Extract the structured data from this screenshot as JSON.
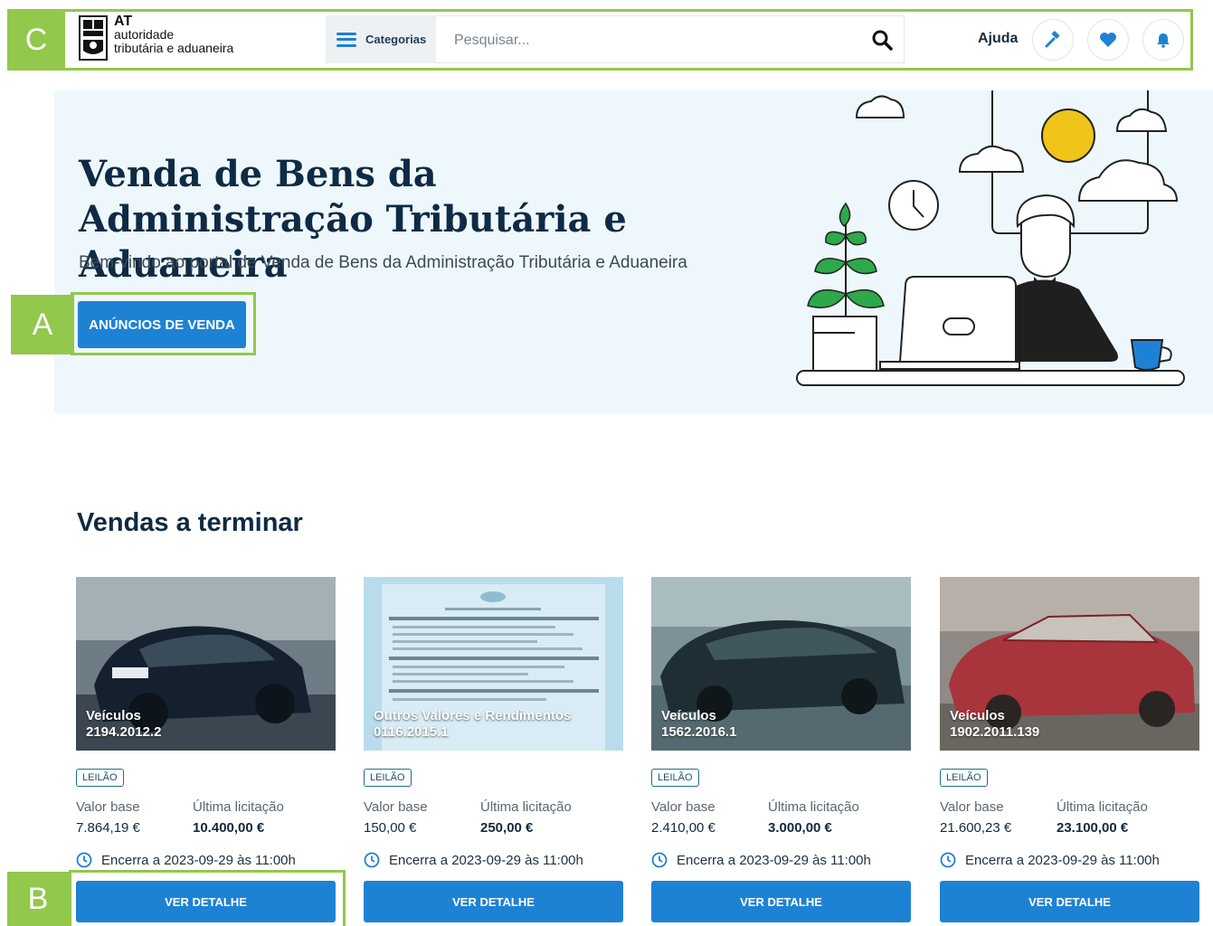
{
  "annotations": {
    "a": "A",
    "b": "B",
    "c": "C"
  },
  "header": {
    "logo_at": "AT",
    "logo_line1": "autoridade",
    "logo_line2": "tributária e aduaneira",
    "categories_label": "Categorias",
    "search_placeholder": "Pesquisar...",
    "help_label": "Ajuda",
    "icons": [
      "gavel-icon",
      "heart-icon",
      "bell-icon"
    ]
  },
  "hero": {
    "title": "Venda de Bens da Administração Tributária e Aduaneira",
    "subtitle": "Bem-vindo ao portal de Venda de Bens da Administração Tributária e Aduaneira",
    "cta_label": "ANÚNCIOS DE VENDA"
  },
  "section": {
    "title": "Vendas a terminar"
  },
  "cards": [
    {
      "category": "Veículos",
      "ref": "2194.2012.2",
      "badge": "LEILÃO",
      "base_label": "Valor base",
      "base_value": "7.864,19 €",
      "last_label": "Última licitação",
      "last_value": "10.400,00 €",
      "ends": "Encerra a 2023-09-29 às 11:00h",
      "button": "VER DETALHE"
    },
    {
      "category": "Outros Valores e Rendimentos",
      "ref": "0116.2015.1",
      "badge": "LEILÃO",
      "base_label": "Valor base",
      "base_value": "150,00 €",
      "last_label": "Última licitação",
      "last_value": "250,00 €",
      "ends": "Encerra a 2023-09-29 às 11:00h",
      "button": "VER DETALHE"
    },
    {
      "category": "Veículos",
      "ref": "1562.2016.1",
      "badge": "LEILÃO",
      "base_label": "Valor base",
      "base_value": "2.410,00 €",
      "last_label": "Última licitação",
      "last_value": "3.000,00 €",
      "ends": "Encerra a 2023-09-29 às 11:00h",
      "button": "VER DETALHE"
    },
    {
      "category": "Veículos",
      "ref": "1902.2011.139",
      "badge": "LEILÃO",
      "base_label": "Valor base",
      "base_value": "21.600,23 €",
      "last_label": "Última licitação",
      "last_value": "23.100,00 €",
      "ends": "Encerra a 2023-09-29 às 11:00h",
      "button": "VER DETALHE"
    }
  ],
  "colors": {
    "accent": "#1e82d4",
    "annotation": "#92c84b",
    "hero_bg": "#eef8fc",
    "heading": "#0f2a44"
  }
}
